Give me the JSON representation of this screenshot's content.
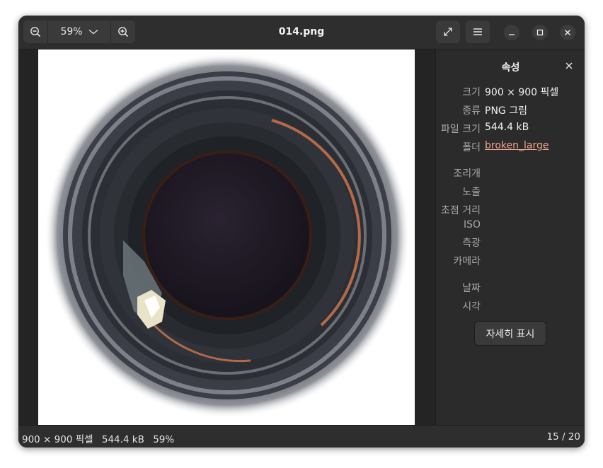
{
  "header": {
    "title": "014.png",
    "zoom_level": "59%",
    "icons": {
      "zoom_out": "zoom-out-icon",
      "zoom_in": "zoom-in-icon",
      "fullscreen": "fullscreen-icon",
      "menu": "hamburger-menu-icon",
      "minimize": "minimize-icon",
      "maximize": "maximize-icon",
      "close": "close-icon"
    }
  },
  "sidebar": {
    "title": "속성",
    "properties": [
      {
        "key": "크기",
        "value": "900 × 900 픽셀"
      },
      {
        "key": "종류",
        "value": "PNG 그림"
      },
      {
        "key": "파일 크기",
        "value": "544.4 kB"
      },
      {
        "key": "폴더",
        "value": "broken_large"
      }
    ],
    "exif": [
      {
        "key": "조리개",
        "value": ""
      },
      {
        "key": "노출",
        "value": ""
      },
      {
        "key": "초점 거리",
        "value": ""
      },
      {
        "key": "ISO",
        "value": ""
      },
      {
        "key": "측광",
        "value": ""
      },
      {
        "key": "카메라",
        "value": ""
      }
    ],
    "datetime": [
      {
        "key": "날짜",
        "value": ""
      },
      {
        "key": "시각",
        "value": ""
      }
    ],
    "details_button": "자세히 표시"
  },
  "status": {
    "dimensions": "900 × 900 픽셀",
    "file_size": "544.4 kB",
    "zoom": "59%",
    "position": "15 / 20"
  },
  "colors": {
    "window_bg": "#242424",
    "headerbar": "#2e2e2e",
    "sidebar_bg": "#2b2b2b",
    "link": "#f0a38c"
  }
}
